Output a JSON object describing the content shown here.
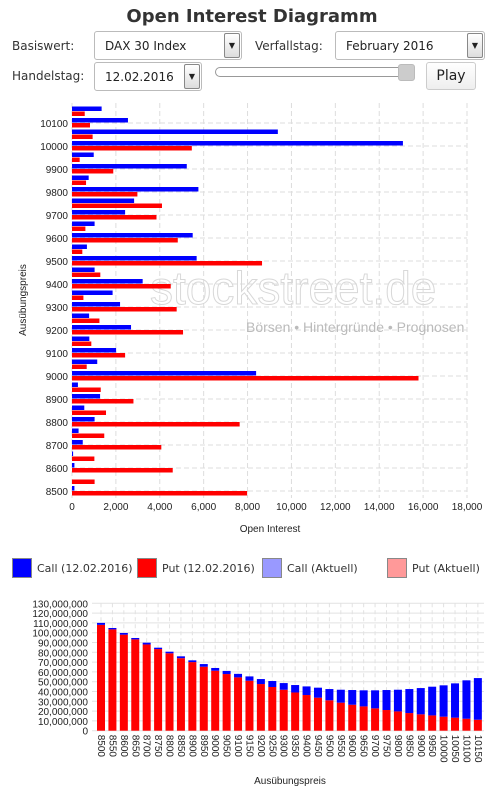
{
  "title": "Open Interest Diagramm",
  "controls": {
    "basiswert_label": "Basiswert:",
    "basiswert_value": "DAX 30 Index",
    "verfallstag_label": "Verfallstag:",
    "verfallstag_value": "February 2016",
    "handelstag_label": "Handelstag:",
    "handelstag_value": "12.02.2016",
    "slider_fraction": 1.0,
    "play_label": "Play"
  },
  "watermark": {
    "brand": "stockstreet.de",
    "tagline": "Börsen • Hintergründe • Prognosen"
  },
  "legend": [
    {
      "label": "Call (12.02.2016)",
      "color": "#0000ff"
    },
    {
      "label": "Put (12.02.2016)",
      "color": "#ff0000"
    },
    {
      "label": "Call (Aktuell)",
      "color": "#9999ff"
    },
    {
      "label": "Put (Aktuell)",
      "color": "#ff9999"
    }
  ],
  "chart_data": [
    {
      "type": "bar",
      "orientation": "horizontal",
      "xlabel": "Open Interest",
      "ylabel": "Ausübungspreis",
      "xlim": [
        0,
        18000
      ],
      "grid": true,
      "xticks": [
        "0",
        "2,000",
        "4,000",
        "6,000",
        "8,000",
        "10,000",
        "12,000",
        "14,000",
        "16,000",
        "18,000"
      ],
      "yticks": [
        "8500",
        "8600",
        "8700",
        "8800",
        "8900",
        "9000",
        "9100",
        "9200",
        "9300",
        "9400",
        "9500",
        "9600",
        "9700",
        "9800",
        "9900",
        "10000",
        "10100"
      ],
      "categories": [
        8500,
        8550,
        8600,
        8650,
        8700,
        8750,
        8800,
        8850,
        8900,
        8950,
        9000,
        9050,
        9100,
        9150,
        9200,
        9250,
        9300,
        9350,
        9400,
        9450,
        9500,
        9550,
        9600,
        9650,
        9700,
        9750,
        9800,
        9850,
        9900,
        9950,
        10000,
        10050,
        10100,
        10150
      ],
      "series": [
        {
          "name": "Call (12.02.2016)",
          "color": "#0000ff",
          "values": [
            110,
            0,
            110,
            50,
            490,
            300,
            1030,
            560,
            1280,
            270,
            8390,
            1150,
            2010,
            790,
            2690,
            780,
            2190,
            1850,
            3220,
            1030,
            5680,
            680,
            5500,
            1030,
            2420,
            2830,
            5760,
            760,
            5230,
            990,
            15080,
            9380,
            2550,
            1350
          ]
        },
        {
          "name": "Put (12.02.2016)",
          "color": "#ff0000",
          "values": [
            7980,
            1030,
            4590,
            1020,
            4070,
            1470,
            7640,
            1550,
            2800,
            1310,
            15790,
            670,
            2420,
            880,
            5060,
            1250,
            4770,
            520,
            4500,
            1290,
            8660,
            470,
            4820,
            610,
            3850,
            4100,
            2980,
            640,
            1880,
            350,
            5460,
            940,
            820,
            580
          ]
        }
      ]
    },
    {
      "type": "bar",
      "stacked": true,
      "xlabel": "Ausübungspreis",
      "ylim": [
        0,
        130000000
      ],
      "grid": true,
      "yticks": [
        "0",
        "10,000,000",
        "20,000,000",
        "30,000,000",
        "40,000,000",
        "50,000,000",
        "60,000,000",
        "70,000,000",
        "80,000,000",
        "90,000,000",
        "100,000,000",
        "110,000,000",
        "120,000,000",
        "130,000,000"
      ],
      "categories": [
        "8500",
        "8550",
        "8600",
        "8650",
        "8700",
        "8750",
        "8800",
        "8850",
        "8900",
        "8950",
        "9000",
        "9050",
        "9100",
        "9150",
        "9200",
        "9250",
        "9300",
        "9350",
        "9400",
        "9450",
        "9500",
        "9550",
        "9600",
        "9650",
        "9700",
        "9750",
        "9800",
        "9850",
        "9900",
        "9950",
        "10000",
        "10050",
        "10100",
        "10150"
      ],
      "series": [
        {
          "name": "Put (12.02.2016)",
          "color": "#ff0000",
          "values": [
            108000000,
            103400000,
            98000000,
            93200000,
            88000000,
            83300000,
            79000000,
            74000000,
            70000000,
            65300000,
            61200000,
            57800000,
            54400000,
            51000000,
            47600000,
            44600000,
            41800000,
            39000000,
            36400000,
            33700000,
            31000000,
            28600000,
            26500000,
            24800000,
            22800000,
            21100000,
            19700000,
            18000000,
            16700000,
            15600000,
            14300000,
            13300000,
            12200000,
            11200000
          ]
        },
        {
          "name": "Call (12.02.2016)",
          "color": "#0000ff",
          "values": [
            2000000,
            1400000,
            1700000,
            1400000,
            1800000,
            1400000,
            1600000,
            1900000,
            1800000,
            2700000,
            2800000,
            3200000,
            3600000,
            4400000,
            5100000,
            6100000,
            6800000,
            7600000,
            8800000,
            10200000,
            11500000,
            13200000,
            15000000,
            16400000,
            18400000,
            20400000,
            22100000,
            24500000,
            26800000,
            29300000,
            32000000,
            35000000,
            39200000,
            42500000
          ]
        }
      ]
    }
  ]
}
